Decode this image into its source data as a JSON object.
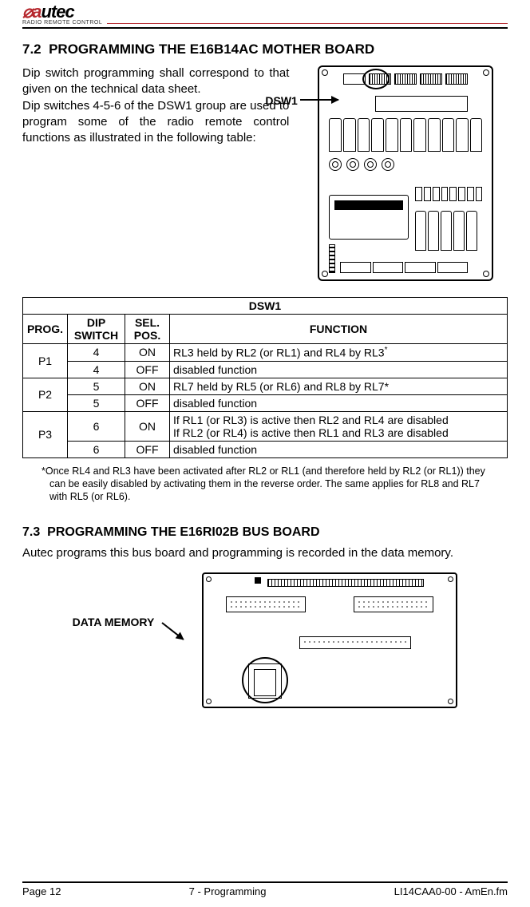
{
  "brand": {
    "name": "autec",
    "tagline": "RADIO REMOTE CONTROL"
  },
  "sections": {
    "s1": {
      "number": "7.2",
      "title": "PROGRAMMING THE E16B14AC MOTHER BOARD",
      "intro": "Dip switch programming shall correspond to that given on the technical data sheet.\nDip switches 4-5-6 of the DSW1 group are used to program some of the radio remote control functions as illustrated in the following table:",
      "figure_label": "DSW1"
    },
    "s2": {
      "number": "7.3",
      "title": "PROGRAMMING THE E16RI02B BUS BOARD",
      "text": "Autec programs this bus board and programming is recorded in the data memory.",
      "figure_label": "DATA MEMORY"
    }
  },
  "table": {
    "title": "DSW1",
    "headers": {
      "prog": "PROG.",
      "dip": "DIP SWITCH",
      "sel": "SEL. POS.",
      "func": "FUNCTION"
    },
    "rows": [
      {
        "prog": "P1",
        "dip": "4",
        "sel": "ON",
        "func": "RL3 held by RL2 (or RL1) and RL4 by RL3",
        "star": true
      },
      {
        "prog": "",
        "dip": "4",
        "sel": "OFF",
        "func": "disabled function"
      },
      {
        "prog": "P2",
        "dip": "5",
        "sel": "ON",
        "func": "RL7 held by RL5 (or RL6) and RL8 by RL7*"
      },
      {
        "prog": "",
        "dip": "5",
        "sel": "OFF",
        "func": "disabled function"
      },
      {
        "prog": "P3",
        "dip": "6",
        "sel": "ON",
        "func": "If RL1 (or RL3) is active then RL2 and RL4 are disabled\nIf RL2 (or RL4) is active then RL1 and RL3 are disabled"
      },
      {
        "prog": "",
        "dip": "6",
        "sel": "OFF",
        "func": "disabled function"
      }
    ]
  },
  "footnote": "*Once RL4 and RL3 have been activated after RL2 or RL1 (and therefore held by RL2 (or RL1)) they can be easily disabled by activating them in the reverse order. The same applies for RL8 and RL7 with RL5 (or RL6).",
  "footer": {
    "left": "Page 12",
    "center": "7 - Programming",
    "right": "LI14CAA0-00 - AmEn.fm"
  }
}
